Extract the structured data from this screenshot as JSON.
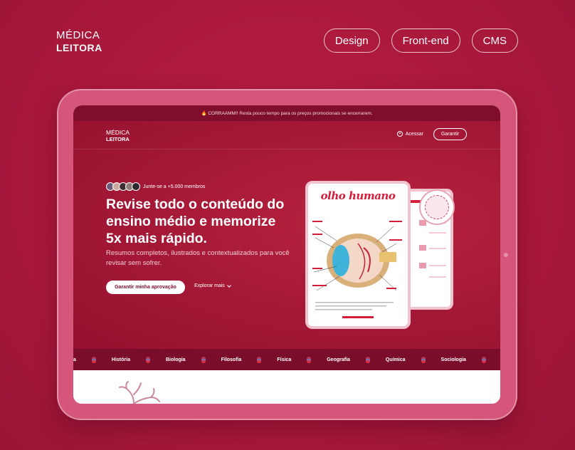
{
  "portfolio": {
    "brand_line1": "MÉDICA",
    "brand_line2": "LEITORA",
    "tags": [
      "Design",
      "Front-end",
      "CMS"
    ]
  },
  "site": {
    "announcement": "🔥 CORRAAMM!! Resta pouco tempo para os preços promocionais se encerrarem.",
    "logo_line1": "MÉDICA",
    "logo_line2": "LEITORA",
    "login_label": "Acessar",
    "cta_label": "Garantir",
    "members_text": "Junte-se a +5.000 membros",
    "headline": "Revise todo o conteúdo do ensino médio e memorize 5x mais rápido.",
    "subtitle": "Resumos completos, ilustrados e contextualizados para você revisar sem sofrer.",
    "primary_button": "Garantir minha aprovação",
    "secondary_button": "Explorar mais",
    "mock_title": "olho humano",
    "subjects": [
      "a",
      "História",
      "Biologia",
      "Filosofia",
      "Física",
      "Geografia",
      "Química",
      "Sociologia"
    ]
  },
  "colors": {
    "background": "#b01a3f",
    "accent_dark": "#7e0e2c",
    "tablet_frame": "#d5567a"
  }
}
